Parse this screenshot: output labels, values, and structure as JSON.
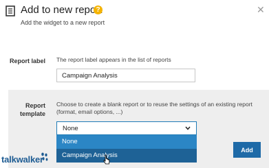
{
  "dialog": {
    "title": "Add to new report",
    "subtitle": "Add the widget to a new report",
    "help_glyph": "?",
    "close_glyph": "✕"
  },
  "report_label": {
    "label": "Report label",
    "description": "The report label appears in the list of reports",
    "value": "Campaign Analysis"
  },
  "report_template": {
    "label_line1": "Report",
    "label_line2": "template",
    "description_line1": "Choose to create a blank report or to reuse the settings of an existing report",
    "description_line2": "(format, email options, ...)",
    "selected": "None",
    "options": [
      "None",
      "Campaign Analysis"
    ]
  },
  "actions": {
    "add_label": "Add"
  },
  "brand": {
    "logo_text": "talkwalker"
  },
  "icons": [
    "document-icon",
    "help-icon",
    "close-icon",
    "chevron-down-icon",
    "cursor-icon",
    "footprint-logo-icon"
  ],
  "colors": {
    "accent": "#1e6aa7",
    "help": "#f5b400",
    "selected_option": "#2b86c5",
    "hover_option": "#1e6296"
  }
}
